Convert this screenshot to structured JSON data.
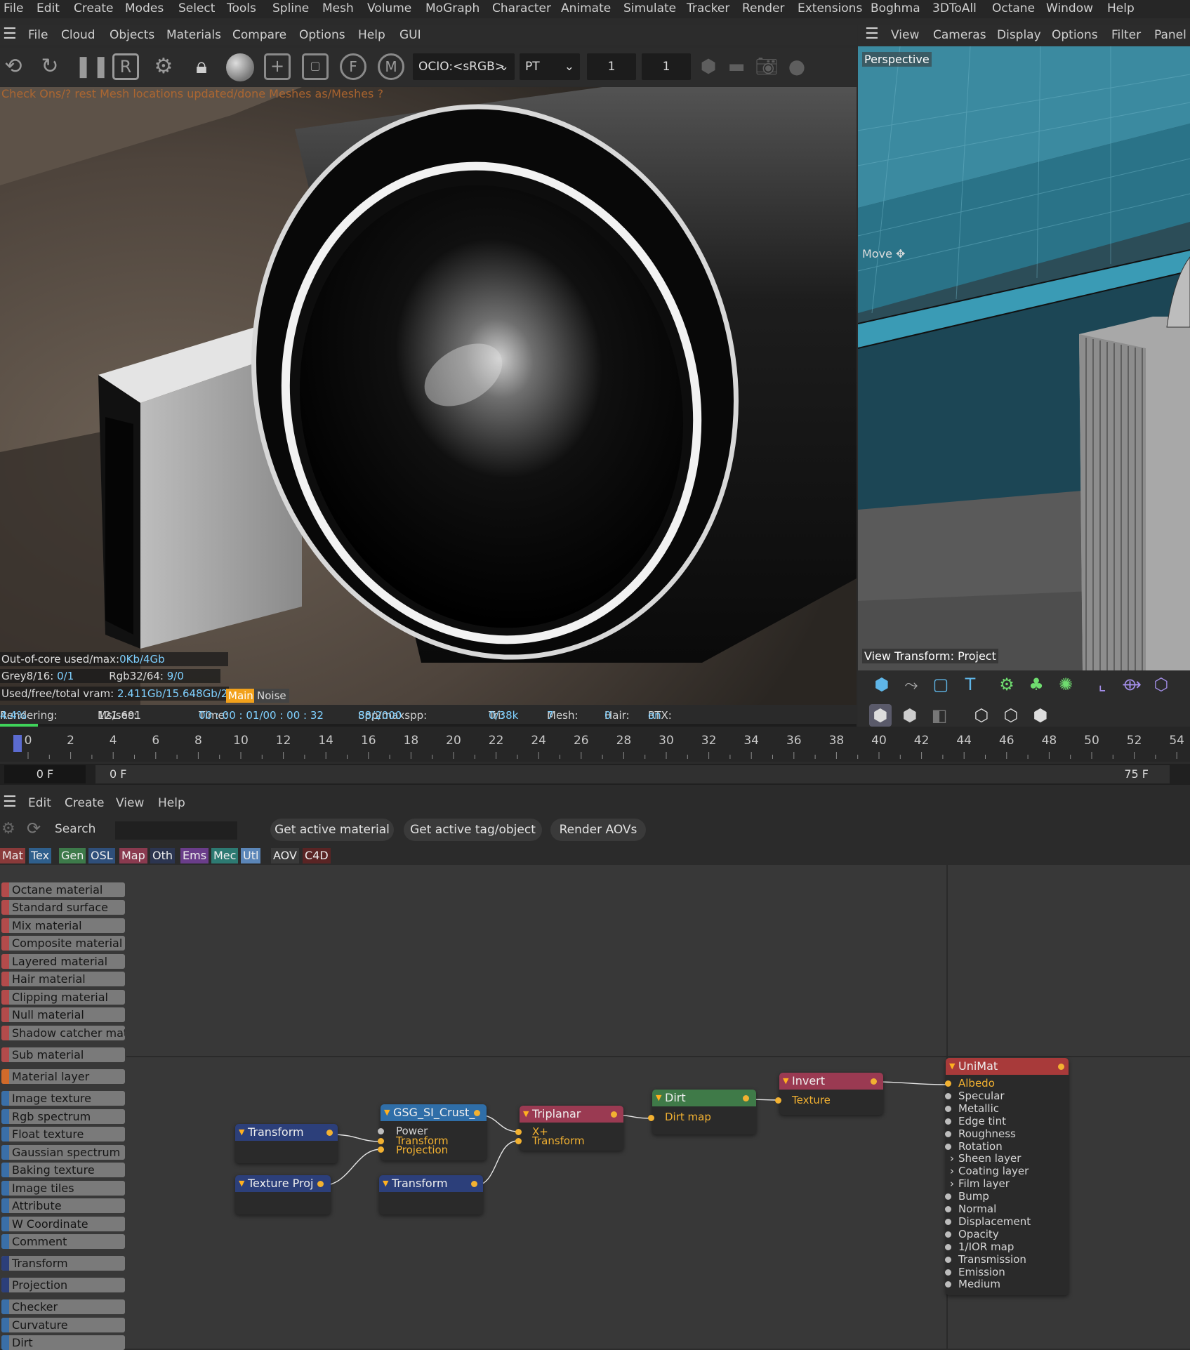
{
  "menubar": {
    "items": [
      "File",
      "Edit",
      "Create",
      "Modes",
      "Select",
      "Tools",
      "Spline",
      "Mesh",
      "Volume",
      "MoGraph",
      "Character",
      "Animate",
      "Simulate",
      "Tracker",
      "Render",
      "Extensions",
      "Boghma",
      "3DToAll",
      "Octane",
      "Window",
      "Help"
    ]
  },
  "render_viewer": {
    "menu": [
      "File",
      "Cloud",
      "Objects",
      "Materials",
      "Compare",
      "Options",
      "Help",
      "GUI"
    ],
    "ocio_select": "OCIO:<sRGB>",
    "kernel_select": "PT",
    "field1": "1",
    "field2": "1",
    "message": "Check Ons/? rest Mesh locations updated/done Meshes as/Meshes ?",
    "stats": {
      "out_of_core_label": "Out-of-core used/max:",
      "out_of_core_value": "0Kb/4Gb",
      "grey_label": "Grey8/16:",
      "grey_value": "0/1",
      "rgb_label": "Rgb32/64:",
      "rgb_value": "9/0",
      "vram_label": "Used/free/total vram:",
      "vram_value": "2.411Gb/15.648Gb/2",
      "tab_main": "Main",
      "tab_noise": "Noise"
    },
    "status": {
      "rendering_label": "Rendering:",
      "rendering_value": "4.4%",
      "ms_label": "Ms/sec:",
      "ms_value": "121.691",
      "time_label": "Time:",
      "time_value": "00 : 00 : 01/00 : 00 : 32",
      "spp_label": "Spp/maxspp:",
      "spp_value": "88/2000",
      "tri_label": "Tri:",
      "tri_value": "0/38k",
      "mesh_label": "Mesh:",
      "mesh_value": "7",
      "hair_label": "Hair:",
      "hair_value": "0",
      "rtx_label": "RTX:",
      "rtx_value": "on"
    },
    "progress": 0.044
  },
  "viewport": {
    "menu": [
      "View",
      "Cameras",
      "Display",
      "Options",
      "Filter",
      "Panel"
    ],
    "camera_label": "Perspective",
    "tool_label": "Move",
    "view_transform": "View Transform: Project"
  },
  "timeline": {
    "ticks": [
      "0",
      "2",
      "4",
      "6",
      "8",
      "10",
      "12",
      "14",
      "16",
      "18",
      "20",
      "22",
      "24",
      "26",
      "28",
      "30",
      "32",
      "34",
      "36",
      "38",
      "40",
      "42",
      "44",
      "46",
      "48",
      "50",
      "52",
      "54"
    ],
    "current_frame": "0 F",
    "start_frame": "0 F",
    "end_frame": "75 F"
  },
  "node_editor": {
    "menu": [
      "Edit",
      "Create",
      "View",
      "Help"
    ],
    "search_label": "Search",
    "search_value": "",
    "buttons": {
      "get_active_material": "Get active material",
      "get_active_tag": "Get active tag/object",
      "render_aovs": "Render AOVs"
    },
    "categories": [
      {
        "label": "Mat",
        "color": "#8a3a3a"
      },
      {
        "label": "Tex",
        "color": "#2f5f8c"
      },
      {
        "label": "Gen",
        "color": "#3d7a4a"
      },
      {
        "label": "OSL",
        "color": "#2f4f7a"
      },
      {
        "label": "Map",
        "color": "#8a3a4f"
      },
      {
        "label": "Oth",
        "color": "#2c3550"
      },
      {
        "label": "Ems",
        "color": "#6a3d8a"
      },
      {
        "label": "Mec",
        "color": "#2d7a72"
      },
      {
        "label": "Utl",
        "color": "#5b86b8"
      },
      {
        "label": "AOV",
        "color": "#3a3a3a"
      },
      {
        "label": "C4D",
        "color": "#5a2424"
      }
    ],
    "sidebar": [
      {
        "label": "Octane material",
        "color": "#b34b4b"
      },
      {
        "label": "Standard surface",
        "color": "#b34b4b"
      },
      {
        "label": "Mix material",
        "color": "#b34b4b"
      },
      {
        "label": "Composite material",
        "color": "#b34b4b"
      },
      {
        "label": "Layered material",
        "color": "#b34b4b"
      },
      {
        "label": "Hair material",
        "color": "#b34b4b"
      },
      {
        "label": "Clipping material",
        "color": "#b34b4b"
      },
      {
        "label": "Null material",
        "color": "#b34b4b"
      },
      {
        "label": "Shadow catcher mat",
        "color": "#b34b4b"
      },
      {
        "label": "Sub material",
        "color": "#b34b4b"
      },
      {
        "label": "Material layer",
        "color": "#d06a2a"
      },
      {
        "label": "Image texture",
        "color": "#3a6fa8"
      },
      {
        "label": "Rgb spectrum",
        "color": "#3a6fa8"
      },
      {
        "label": "Float texture",
        "color": "#3a6fa8"
      },
      {
        "label": "Gaussian spectrum",
        "color": "#3a6fa8"
      },
      {
        "label": "Baking texture",
        "color": "#3a6fa8"
      },
      {
        "label": "Image tiles",
        "color": "#3a6fa8"
      },
      {
        "label": "Attribute",
        "color": "#3a6fa8"
      },
      {
        "label": "W Coordinate",
        "color": "#3a6fa8"
      },
      {
        "label": "Comment",
        "color": "#3a6fa8"
      },
      {
        "label": "Transform",
        "color": "#2c3f7a"
      },
      {
        "label": "Projection",
        "color": "#2c3f7a"
      },
      {
        "label": "Checker",
        "color": "#3a6fa8"
      },
      {
        "label": "Curvature",
        "color": "#3a6fa8"
      },
      {
        "label": "Dirt",
        "color": "#3a6fa8"
      }
    ],
    "nodes": {
      "transform1": {
        "title": "Transform",
        "color": "#2c3f7a"
      },
      "texproj": {
        "title": "Texture Proj",
        "color": "#2c3f7a"
      },
      "gsg": {
        "title": "GSG_SI_Crust_",
        "color": "#2f6ea8",
        "pins": [
          "Power",
          "Transform",
          "Projection"
        ]
      },
      "transform2": {
        "title": "Transform",
        "color": "#2c3f7a"
      },
      "triplanar": {
        "title": "Triplanar",
        "color": "#9a3a52",
        "pins": [
          "X+",
          "Transform"
        ]
      },
      "dirt": {
        "title": "Dirt",
        "color": "#3f7a48",
        "pins": [
          "Dirt map"
        ]
      },
      "invert": {
        "title": "Invert",
        "color": "#9a3a52",
        "pins": [
          "Texture"
        ]
      },
      "unimat": {
        "title": "UniMat",
        "color": "#a83a3a",
        "pins": [
          "Albedo",
          "Specular",
          "Metallic",
          "Edge tint",
          "Roughness",
          "Rotation",
          "Sheen layer",
          "Coating layer",
          "Film layer",
          "Bump",
          "Normal",
          "Displacement",
          "Opacity",
          "1/IOR map",
          "Transmission",
          "Emission",
          "Medium"
        ]
      }
    }
  }
}
